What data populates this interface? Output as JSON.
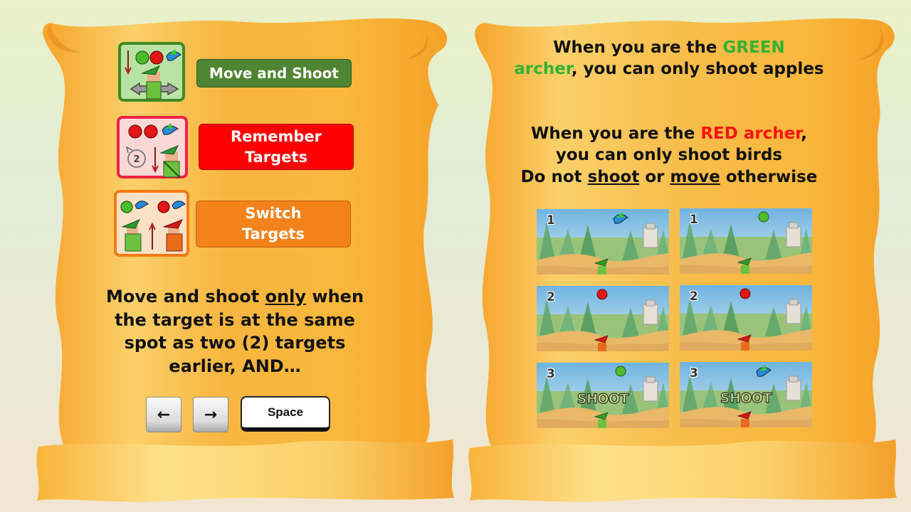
{
  "left_panel": {
    "modes": [
      {
        "label": "Move and Shoot",
        "bg": "#4e8533",
        "border": "#2f5a1f",
        "icon_border": "#3f8a22",
        "icon_bg": "#b9e3a4"
      },
      {
        "label": "Remember\nTargets",
        "bg": "#ff0000",
        "border": "#b00000",
        "icon_border": "#ee2244",
        "icon_bg": "#fbd8d6"
      },
      {
        "label": "Switch\nTargets",
        "bg": "#f4821b",
        "border": "#c2620f",
        "icon_border": "#f47a14",
        "icon_bg": "#fbe2c6"
      }
    ],
    "rule": {
      "p1": "Move and shoot ",
      "p2": "only",
      "p3": " when the target is at the same spot as two (2) targets earlier, AND…"
    },
    "icon_number": "2",
    "keys": {
      "left_arrow": "←",
      "right_arrow": "→",
      "space": "Space"
    }
  },
  "right_panel": {
    "green": {
      "pre": "When you are the ",
      "color_word": "GREEN",
      "color_word2": "archer",
      "post": ", you can only shoot apples",
      "color": "#33b233"
    },
    "red": {
      "pre": "When you are the ",
      "color_word": "RED archer",
      "post": ",\nyou can only shoot birds",
      "color": "#ff1111"
    },
    "dont": {
      "pre": "Do not ",
      "w1": "shoot",
      "mid": " or ",
      "w2": "move",
      "post": " otherwise"
    },
    "scenes": [
      {
        "num": "1",
        "target": "bird",
        "archer": "green",
        "shoot": ""
      },
      {
        "num": "1",
        "target": "green-apple",
        "archer": "green",
        "shoot": ""
      },
      {
        "num": "2",
        "target": "red-apple",
        "archer": "red",
        "shoot": ""
      },
      {
        "num": "2",
        "target": "red-apple",
        "archer": "red",
        "shoot": ""
      },
      {
        "num": "3",
        "target": "green-apple",
        "archer": "green",
        "shoot": "SHOOT"
      },
      {
        "num": "3",
        "target": "bird",
        "archer": "red",
        "shoot": "SHOOT"
      }
    ]
  },
  "colors": {
    "scroll_light": "#fde08a",
    "scroll_dark": "#f6a52c",
    "text": "#111111"
  }
}
